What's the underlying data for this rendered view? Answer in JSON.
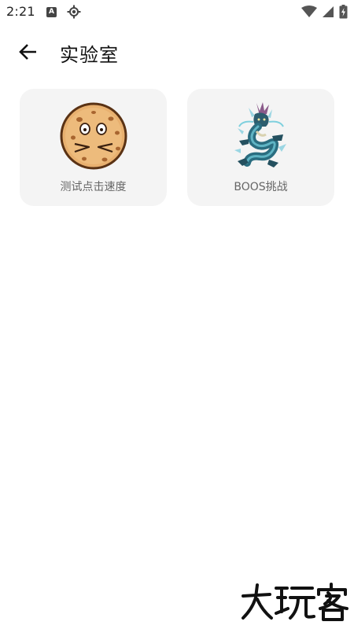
{
  "status_bar": {
    "time": "2:21",
    "icons": [
      "app-a-icon",
      "location-icon",
      "wifi-icon",
      "signal-icon",
      "battery-charging-icon"
    ]
  },
  "header": {
    "back_icon": "arrow-left-icon",
    "title": "实验室"
  },
  "cards": [
    {
      "label": "测试点击速度",
      "icon": "cookie-face-icon"
    },
    {
      "label": "BOOS挑战",
      "icon": "dragon-icon"
    }
  ],
  "watermark": {
    "text": "大玩客"
  },
  "colors": {
    "background": "#ffffff",
    "card_background": "#f4f4f4",
    "label_text": "#666666",
    "title_text": "#111111"
  }
}
